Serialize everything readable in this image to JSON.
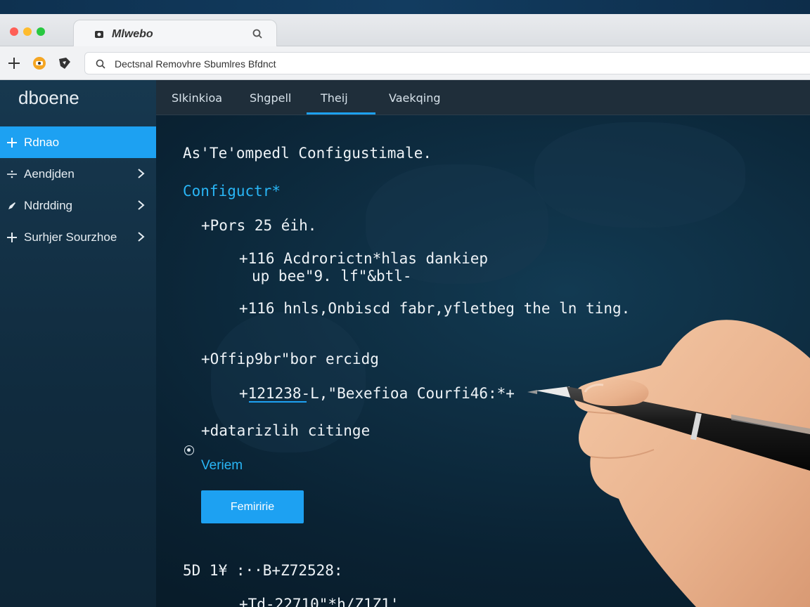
{
  "browser": {
    "tab_title": "Mlwebo",
    "address": "Dectsnal Removhre Sbumlres Bfdnct",
    "traffic_lights": [
      "#ff5f57",
      "#febc2e",
      "#28c840"
    ]
  },
  "sidebar": {
    "brand": "dboene",
    "items": [
      {
        "label": "Rdnao",
        "icon": "plus-icon",
        "active": true,
        "chevron": false
      },
      {
        "label": "Aendjden",
        "icon": "divide-icon",
        "active": false,
        "chevron": true
      },
      {
        "label": "Ndrdding",
        "icon": "pen-icon",
        "active": false,
        "chevron": true
      },
      {
        "label": "Surhjer Sourzhoe",
        "icon": "plus-icon",
        "active": false,
        "chevron": true
      }
    ]
  },
  "topnav": {
    "items": [
      "SIkinkioa",
      "Shgpell",
      "Theij",
      "Vaekqing"
    ],
    "active_index": 2
  },
  "content": {
    "heading": "As'Te'ompedl Configustimale.",
    "section": "Configuctr*",
    "lines": [
      "+Pors 25 éih.",
      "+116 Acdrorictn*hlas dankiep",
      "up bee\"9. lf\"&btl-",
      "+116 hnls,Onbiscd fabr,yfletbeg the ln ting.",
      "+Offip9br\"bor ercidg",
      "+121238-L,\"Bexefioa Courfi46:*+",
      "+datarizlih citinge",
      "5D 1¥ :··B+Z72528:",
      "+Td-22710\"*h/Z1Z1'"
    ],
    "verify_label": "Veriem",
    "button_label": "Femiririe"
  },
  "colors": {
    "accent": "#1da1f2",
    "accent_text": "#29b6f6"
  }
}
